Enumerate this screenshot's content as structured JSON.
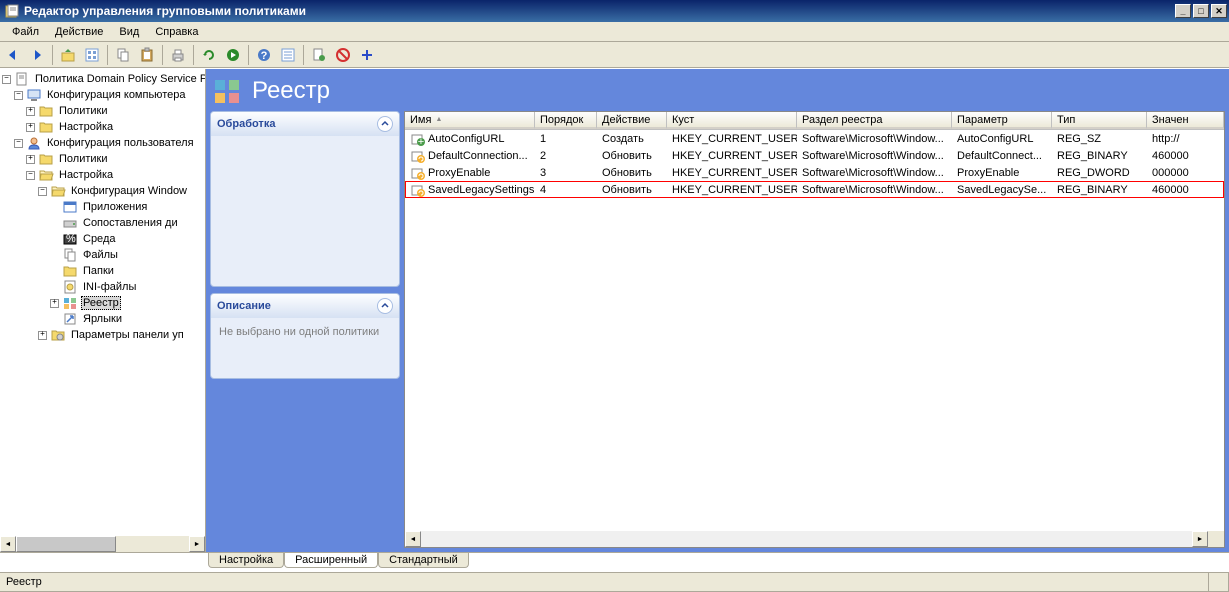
{
  "window": {
    "title": "Редактор управления групповыми политиками"
  },
  "menu": {
    "file": "Файл",
    "action": "Действие",
    "view": "Вид",
    "help": "Справка"
  },
  "tree": {
    "root": "Политика Domain Policy Service Pl",
    "comp_config": "Конфигурация компьютера",
    "comp_policies": "Политики",
    "comp_settings": "Настройка",
    "user_config": "Конфигурация пользователя",
    "user_policies": "Политики",
    "user_settings": "Настройка",
    "win_config": "Конфигурация Window",
    "apps": "Приложения",
    "drive_maps": "Сопоставления ди",
    "env": "Среда",
    "files": "Файлы",
    "folders": "Папки",
    "ini": "INI-файлы",
    "registry": "Реестр",
    "shortcuts": "Ярлыки",
    "ctrl_panel": "Параметры панели уп"
  },
  "header": {
    "title": "Реестр"
  },
  "panels": {
    "processing": {
      "title": "Обработка"
    },
    "description": {
      "title": "Описание",
      "text": "Не выбрано ни одной политики"
    }
  },
  "list": {
    "columns": {
      "name": "Имя",
      "order": "Порядок",
      "action": "Действие",
      "hive": "Куст",
      "key": "Раздел реестра",
      "param": "Параметр",
      "type": "Тип",
      "value": "Значен"
    },
    "rows": [
      {
        "name": "AutoConfigURL",
        "order": "1",
        "action": "Создать",
        "hive": "HKEY_CURRENT_USER",
        "key": "Software\\Microsoft\\Window...",
        "param": "AutoConfigURL",
        "type": "REG_SZ",
        "value": "http://",
        "icon": "create"
      },
      {
        "name": "DefaultConnection...",
        "order": "2",
        "action": "Обновить",
        "hive": "HKEY_CURRENT_USER",
        "key": "Software\\Microsoft\\Window...",
        "param": "DefaultConnect...",
        "type": "REG_BINARY",
        "value": "460000",
        "icon": "update"
      },
      {
        "name": "ProxyEnable",
        "order": "3",
        "action": "Обновить",
        "hive": "HKEY_CURRENT_USER",
        "key": "Software\\Microsoft\\Window...",
        "param": "ProxyEnable",
        "type": "REG_DWORD",
        "value": "000000",
        "icon": "update"
      },
      {
        "name": "SavedLegacySettings",
        "order": "4",
        "action": "Обновить",
        "hive": "HKEY_CURRENT_USER",
        "key": "Software\\Microsoft\\Window...",
        "param": "SavedLegacySe...",
        "type": "REG_BINARY",
        "value": "460000",
        "icon": "update",
        "highlighted": true
      }
    ]
  },
  "tabs": {
    "settings": "Настройка",
    "extended": "Расширенный",
    "standard": "Стандартный"
  },
  "statusbar": {
    "text": "Реестр"
  }
}
